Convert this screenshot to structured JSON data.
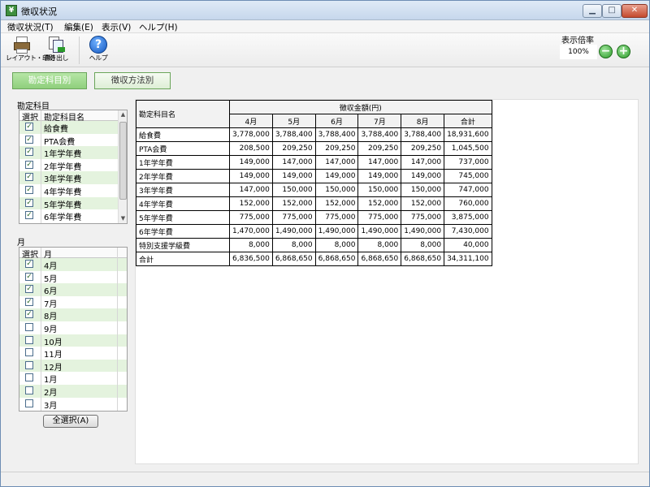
{
  "window": {
    "title": "徴収状況"
  },
  "menu": [
    "徴収状況(T)",
    "編集(E)",
    "表示(V)",
    "ヘルプ(H)"
  ],
  "toolbar": {
    "print_label": "レイアウト・印刷",
    "export_label": "書き出し",
    "help_label": "ヘルプ"
  },
  "zoom": {
    "title": "表示倍率",
    "value": "100%"
  },
  "modes": {
    "active": "勘定科目別",
    "inactive": "徴収方法別"
  },
  "accounts_panel": {
    "label": "勘定科目",
    "col_select": "選択",
    "col_name": "勘定科目名",
    "items": [
      {
        "name": "給食費",
        "checked": true
      },
      {
        "name": "PTA会費",
        "checked": true
      },
      {
        "name": "1年学年費",
        "checked": true
      },
      {
        "name": "2年学年費",
        "checked": true
      },
      {
        "name": "3年学年費",
        "checked": true
      },
      {
        "name": "4年学年費",
        "checked": true
      },
      {
        "name": "5年学年費",
        "checked": true
      },
      {
        "name": "6年学年費",
        "checked": true
      }
    ]
  },
  "months_panel": {
    "label": "月",
    "col_select": "選択",
    "col_month": "月",
    "items": [
      {
        "name": "4月",
        "checked": true
      },
      {
        "name": "5月",
        "checked": true
      },
      {
        "name": "6月",
        "checked": true
      },
      {
        "name": "7月",
        "checked": true
      },
      {
        "name": "8月",
        "checked": true
      },
      {
        "name": "9月",
        "checked": false
      },
      {
        "name": "10月",
        "checked": false
      },
      {
        "name": "11月",
        "checked": false
      },
      {
        "name": "12月",
        "checked": false
      },
      {
        "name": "1月",
        "checked": false
      },
      {
        "name": "2月",
        "checked": false
      },
      {
        "name": "3月",
        "checked": false
      }
    ],
    "select_all_label": "全選択(A)"
  },
  "table": {
    "row_header": "勘定科目名",
    "group_header": "徴収金額(円)",
    "columns": [
      "4月",
      "5月",
      "6月",
      "7月",
      "8月",
      "合計"
    ],
    "rows": [
      {
        "name": "給食費",
        "values": [
          "3,778,000",
          "3,788,400",
          "3,788,400",
          "3,788,400",
          "3,788,400",
          "18,931,600"
        ]
      },
      {
        "name": "PTA会費",
        "values": [
          "208,500",
          "209,250",
          "209,250",
          "209,250",
          "209,250",
          "1,045,500"
        ]
      },
      {
        "name": "1年学年費",
        "values": [
          "149,000",
          "147,000",
          "147,000",
          "147,000",
          "147,000",
          "737,000"
        ]
      },
      {
        "name": "2年学年費",
        "values": [
          "149,000",
          "149,000",
          "149,000",
          "149,000",
          "149,000",
          "745,000"
        ]
      },
      {
        "name": "3年学年費",
        "values": [
          "147,000",
          "150,000",
          "150,000",
          "150,000",
          "150,000",
          "747,000"
        ]
      },
      {
        "name": "4年学年費",
        "values": [
          "152,000",
          "152,000",
          "152,000",
          "152,000",
          "152,000",
          "760,000"
        ]
      },
      {
        "name": "5年学年費",
        "values": [
          "775,000",
          "775,000",
          "775,000",
          "775,000",
          "775,000",
          "3,875,000"
        ]
      },
      {
        "name": "6年学年費",
        "values": [
          "1,470,000",
          "1,490,000",
          "1,490,000",
          "1,490,000",
          "1,490,000",
          "7,430,000"
        ]
      },
      {
        "name": "特別支援学級費",
        "values": [
          "8,000",
          "8,000",
          "8,000",
          "8,000",
          "8,000",
          "40,000"
        ]
      },
      {
        "name": "合計",
        "values": [
          "6,836,500",
          "6,868,650",
          "6,868,650",
          "6,868,650",
          "6,868,650",
          "34,311,100"
        ]
      }
    ]
  }
}
